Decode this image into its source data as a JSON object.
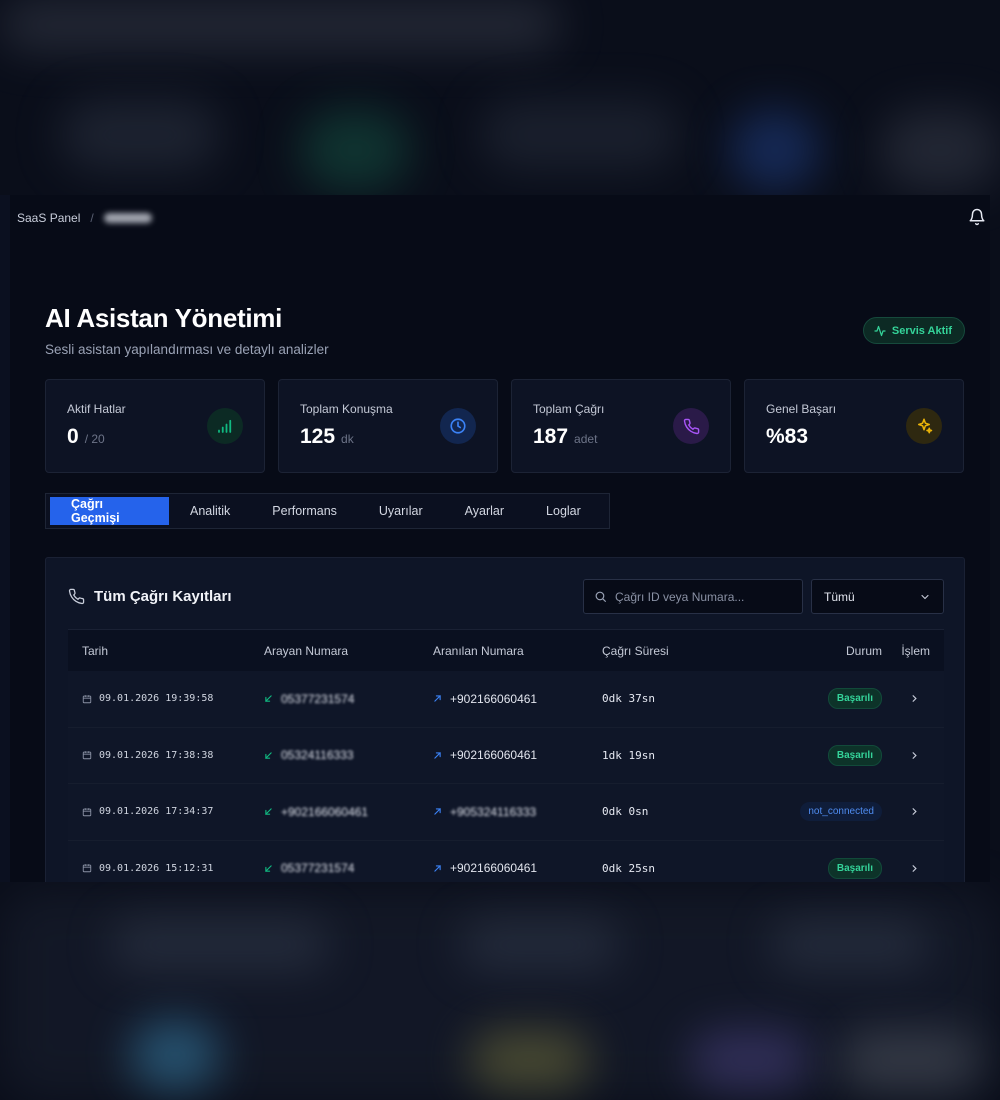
{
  "breadcrumb": {
    "root": "SaaS Panel",
    "separator": "/"
  },
  "header": {
    "title": "AI Asistan Yönetimi",
    "subtitle": "Sesli asistan yapılandırması ve detaylı analizler",
    "status": "Servis Aktif"
  },
  "stats": [
    {
      "label": "Aktif Hatlar",
      "value": "0",
      "unit": "/ 20",
      "icon": "signal-icon",
      "color": "#10b981"
    },
    {
      "label": "Toplam Konuşma",
      "value": "125",
      "unit": "dk",
      "icon": "clock-icon",
      "color": "#3b82f6"
    },
    {
      "label": "Toplam Çağrı",
      "value": "187",
      "unit": "adet",
      "icon": "phone-icon",
      "color": "#a855f7"
    },
    {
      "label": "Genel Başarı",
      "value": "%83",
      "unit": "",
      "icon": "sparkles-icon",
      "color": "#eab308"
    }
  ],
  "tabs": [
    "Çağrı Geçmişi",
    "Analitik",
    "Performans",
    "Uyarılar",
    "Ayarlar",
    "Loglar"
  ],
  "calls": {
    "title": "Tüm Çağrı Kayıtları",
    "search_placeholder": "Çağrı ID veya Numara...",
    "filter_value": "Tümü",
    "columns": [
      "Tarih",
      "Arayan Numara",
      "Aranılan Numara",
      "Çağrı Süresi",
      "Durum",
      "İşlem"
    ],
    "rows": [
      {
        "date": "09.01.2026 19:39:58",
        "caller": "05377231574",
        "callee": "+902166060461",
        "duration": "0dk 37sn",
        "status": "Başarılı",
        "status_kind": "ok"
      },
      {
        "date": "09.01.2026 17:38:38",
        "caller": "05324116333",
        "callee": "+902166060461",
        "duration": "1dk 19sn",
        "status": "Başarılı",
        "status_kind": "ok"
      },
      {
        "date": "09.01.2026 17:34:37",
        "caller": "+902166060461",
        "callee": "+905324116333",
        "duration": "0dk 0sn",
        "status": "not_connected",
        "status_kind": "nc"
      },
      {
        "date": "09.01.2026 15:12:31",
        "caller": "05377231574",
        "callee": "+902166060461",
        "duration": "0dk 25sn",
        "status": "Başarılı",
        "status_kind": "ok"
      }
    ]
  }
}
